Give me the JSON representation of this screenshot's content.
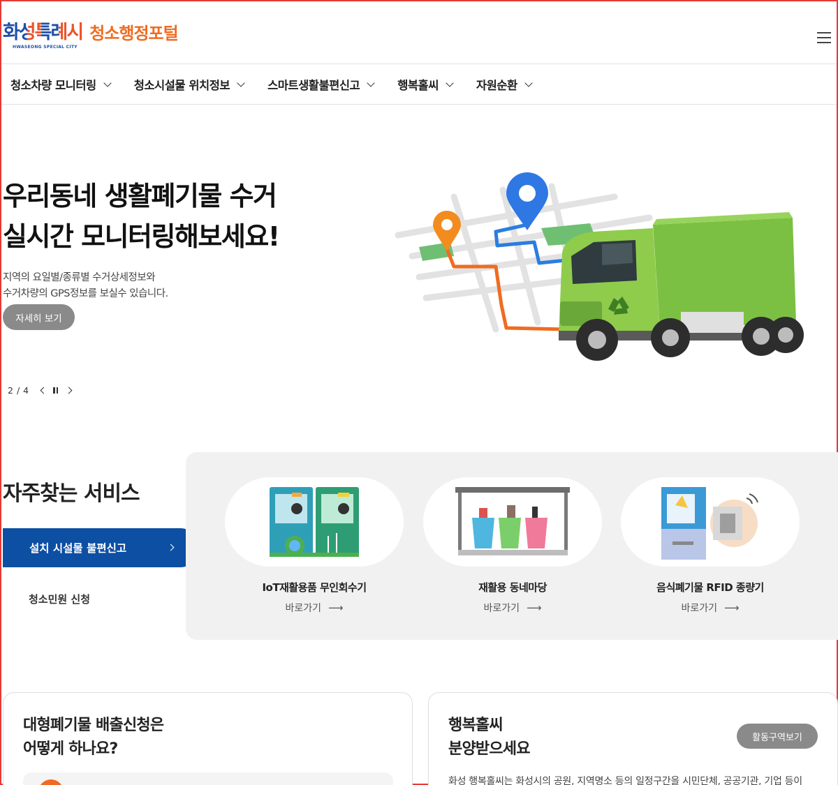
{
  "header": {
    "logo_city_ko": "화성특례시",
    "logo_city_en": "HWASEONG SPECIAL CITY",
    "logo_portal": "청소행정포털"
  },
  "nav": {
    "items": [
      {
        "label": "청소차량 모니터링"
      },
      {
        "label": "청소시설물 위치정보"
      },
      {
        "label": "스마트생활불편신고"
      },
      {
        "label": "행복홀씨"
      },
      {
        "label": "자원순환"
      }
    ]
  },
  "hero": {
    "title_line1": "우리동네 생활폐기물 수거",
    "title_line2": "실시간 모니터링해보세요!",
    "desc_line1": "지역의 요일별/종류별 수거상세정보와",
    "desc_line2": "수거차량의 GPS정보를 보실수 있습니다.",
    "button_label": "자세히 보기",
    "slide_current": "2",
    "slide_total": "4"
  },
  "services": {
    "title": "자주찾는 서비스",
    "tabs": [
      {
        "label": "설치 시설물 불편신고",
        "active": true
      },
      {
        "label": "청소민원 신청",
        "active": false
      }
    ],
    "cards": [
      {
        "name": "IoT재활용품 무인회수기",
        "link": "바로가기"
      },
      {
        "name": "재활용 동네마당",
        "link": "바로가기"
      },
      {
        "name": "음식폐기물 RFID 종량기",
        "link": "바로가기"
      }
    ]
  },
  "bottom": {
    "card1": {
      "title_line1": "대형폐기물 배출신청은",
      "title_line2": "어떻게 하나요?"
    },
    "card2": {
      "title_line1": "행복홀씨",
      "title_line2": "분양받으세요",
      "button_label": "활동구역보기",
      "text": "화성 행복홀씨는 화성시의 공원, 지역명소 등의 일정구간을 시민단체, 공공기관, 기업 등이"
    }
  },
  "colors": {
    "brand_blue": "#0d4fa3",
    "brand_orange": "#ef6c20",
    "button_gray": "#8a8a8a",
    "truck_green": "#7cc043"
  }
}
